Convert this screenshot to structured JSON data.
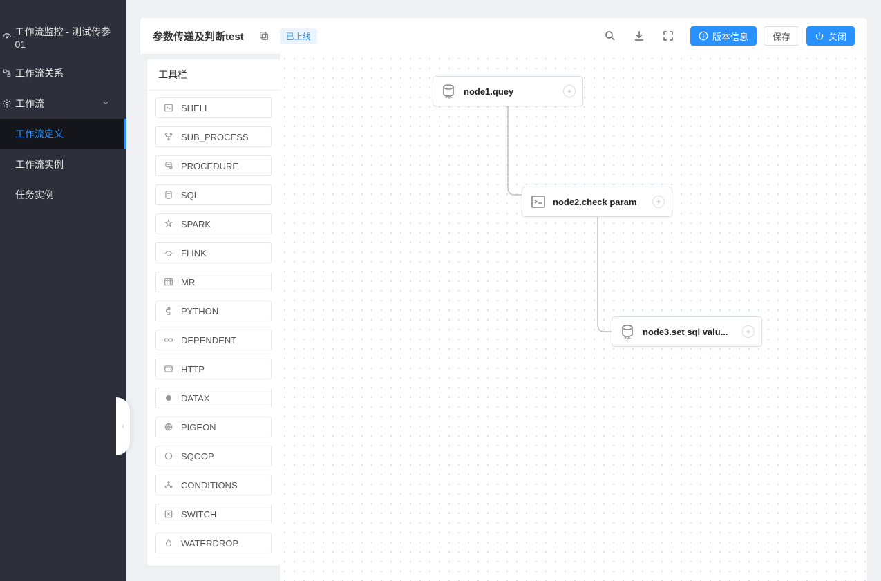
{
  "sidebar": {
    "items": [
      {
        "label": "工作流监控 - 测试传参01"
      },
      {
        "label": "工作流关系"
      },
      {
        "label": "工作流"
      },
      {
        "label": "工作流定义"
      },
      {
        "label": "工作流实例"
      },
      {
        "label": "任务实例"
      }
    ]
  },
  "header": {
    "title": "参数传递及判断test",
    "status": "已上线",
    "buttons": {
      "version": "版本信息",
      "save": "保存",
      "close": "关闭"
    }
  },
  "toolbox": {
    "title": "工具栏",
    "items": [
      "SHELL",
      "SUB_PROCESS",
      "PROCEDURE",
      "SQL",
      "SPARK",
      "FLINK",
      "MR",
      "PYTHON",
      "DEPENDENT",
      "HTTP",
      "DATAX",
      "PIGEON",
      "SQOOP",
      "CONDITIONS",
      "SWITCH",
      "WATERDROP"
    ]
  },
  "dag": {
    "nodes": [
      {
        "name": "node1.quey",
        "type": "SQL"
      },
      {
        "name": "node2.check param",
        "type": "SHELL"
      },
      {
        "name": "node3.set sql valu...",
        "type": "SQL"
      }
    ]
  }
}
